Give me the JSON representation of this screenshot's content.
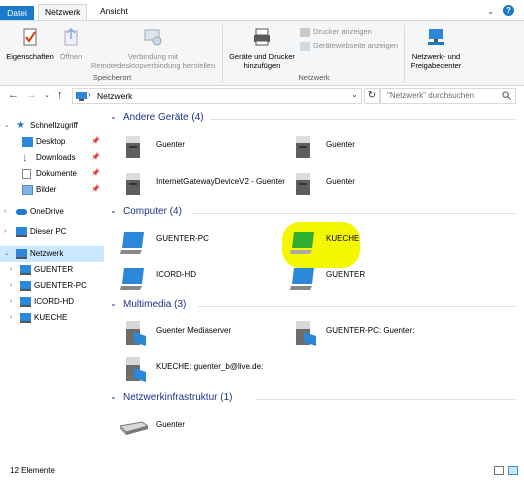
{
  "tabs": {
    "file": "Datei",
    "network": "Netzwerk",
    "view": "Ansicht"
  },
  "ribbon": {
    "properties": "Eigenschaften",
    "open": "Öffnen",
    "remote_line1": "Verbindung mit",
    "remote_line2": "Remotedesktopverbindung herstellen",
    "group_location": "Speicherort",
    "add_devices_line1": "Geräte und Drucker",
    "add_devices_line2": "hinzufügen",
    "show_printers": "Drucker anzeigen",
    "show_device_web": "Gerätewebseite anzeigen",
    "group_network": "Netzwerk",
    "network_center_line1": "Netzwerk- und",
    "network_center_line2": "Freigabecenter"
  },
  "address": {
    "path": "Netzwerk",
    "search_placeholder": "\"Netzwerk\" durchsuchen"
  },
  "sidebar": {
    "quick_access": "Schnellzugriff",
    "desktop": "Desktop",
    "downloads": "Downloads",
    "documents": "Dokumente",
    "pictures": "Bilder",
    "onedrive": "OneDrive",
    "this_pc": "Dieser PC",
    "network": "Netzwerk",
    "computers": [
      "GUENTER",
      "GUENTER-PC",
      "ICORD-HD",
      "KUECHE"
    ]
  },
  "sections": {
    "other": "Andere Geräte (4)",
    "computer": "Computer (4)",
    "multimedia": "Multimedia (3)",
    "infra": "Netzwerkinfrastruktur (1)"
  },
  "items": {
    "other": [
      "Guenter",
      "Guenter",
      "InternetGatewayDeviceV2 - Guenter",
      "Guenter"
    ],
    "computer": [
      "GUENTER-PC",
      "KUECHE",
      "ICORD-HD",
      "GUENTER"
    ],
    "multimedia": [
      "Guenter Mediaserver",
      "GUENTER-PC: Guenter:",
      "KUECHE: guenter_b@live.de:"
    ],
    "infra": [
      "Guenter"
    ]
  },
  "status": {
    "count": "12 Elemente"
  },
  "colors": {
    "accent": "#1979ca",
    "section_title": "#1e3287",
    "selection": "#cce8ff",
    "highlight": "#f5f700"
  }
}
